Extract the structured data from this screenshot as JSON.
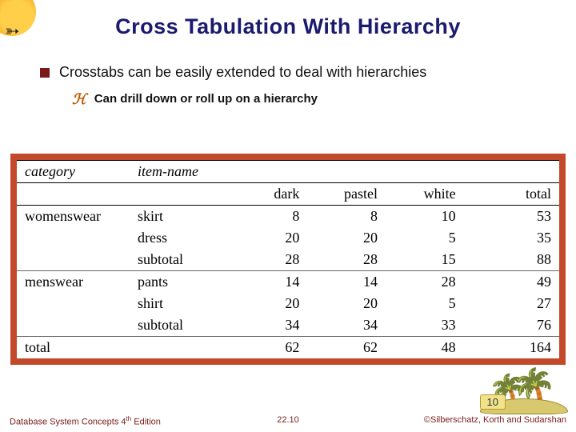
{
  "title": "Cross Tabulation With Hierarchy",
  "bullets": {
    "main": "Crosstabs can be easily extended to deal with hierarchies",
    "sub": "Can drill down or roll up on a hierarchy"
  },
  "table": {
    "head": {
      "c1": "category",
      "c2": "item-name"
    },
    "cols": {
      "a": "dark",
      "b": "pastel",
      "c": "white",
      "d": "total"
    },
    "rows": [
      {
        "cat": "womenswear",
        "item": "skirt",
        "a": "8",
        "b": "8",
        "c": "10",
        "d": "53"
      },
      {
        "cat": "",
        "item": "dress",
        "a": "20",
        "b": "20",
        "c": "5",
        "d": "35"
      },
      {
        "cat": "",
        "item": "subtotal",
        "a": "28",
        "b": "28",
        "c": "15",
        "d": "88"
      },
      {
        "cat": "menswear",
        "item": "pants",
        "a": "14",
        "b": "14",
        "c": "28",
        "d": "49"
      },
      {
        "cat": "",
        "item": "shirt",
        "a": "20",
        "b": "20",
        "c": "5",
        "d": "27"
      },
      {
        "cat": "",
        "item": "subtotal",
        "a": "34",
        "b": "34",
        "c": "33",
        "d": "76"
      },
      {
        "cat": "total",
        "item": "",
        "a": "62",
        "b": "62",
        "c": "48",
        "d": "164"
      }
    ]
  },
  "page_badge": "10",
  "footer": {
    "left_a": "Database System Concepts 4",
    "left_b": "th",
    "left_c": " Edition",
    "center": "22.10",
    "right": "©Silberschatz, Korth and Sudarshan"
  }
}
